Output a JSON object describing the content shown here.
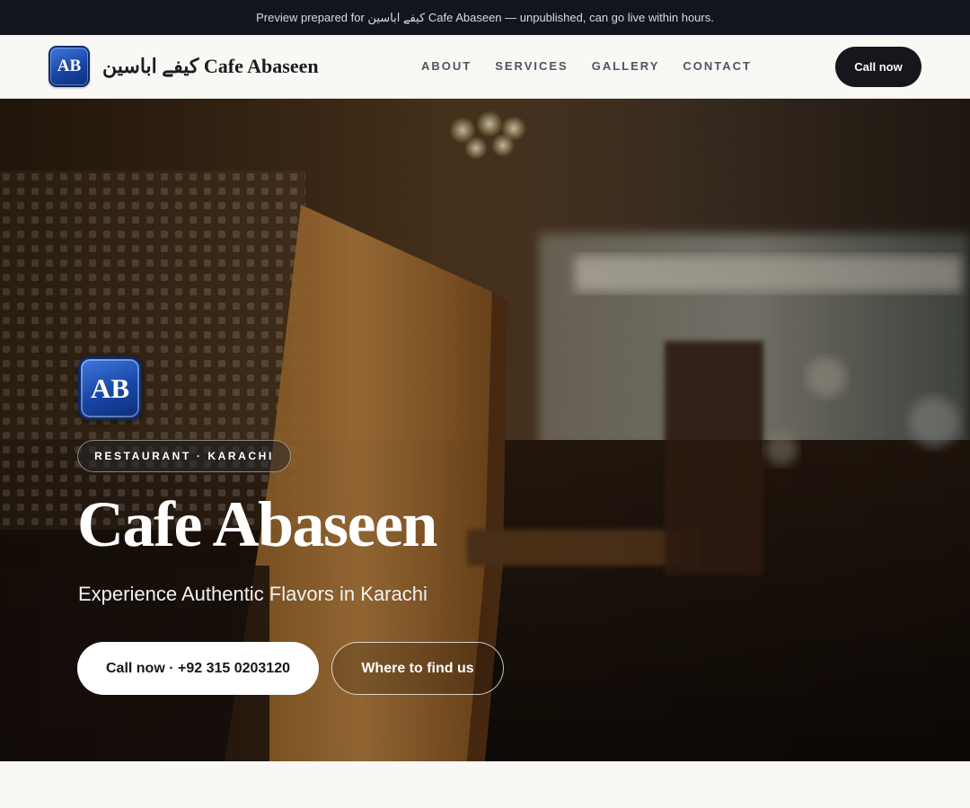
{
  "preview_banner": {
    "text": "Preview prepared for کیفے اباسین Cafe Abaseen — unpublished, can go live within hours."
  },
  "header": {
    "logo_initials": "AB",
    "brand_name": "کیفے اباسین Cafe Abaseen",
    "nav": [
      {
        "label": "ABOUT"
      },
      {
        "label": "SERVICES"
      },
      {
        "label": "GALLERY"
      },
      {
        "label": "CONTACT"
      }
    ],
    "cta_label": "Call now"
  },
  "hero": {
    "logo_initials": "AB",
    "category": "RESTAURANT · KARACHI",
    "title": "Cafe Abaseen",
    "tagline": "Experience Authentic Flavors in Karachi",
    "primary_button": "Call now · +92 315 0203120",
    "secondary_button": "Where to find us"
  },
  "colors": {
    "dark": "#12151b",
    "page_background": "#f9f8f5",
    "logo_blue": "#1846a6"
  }
}
